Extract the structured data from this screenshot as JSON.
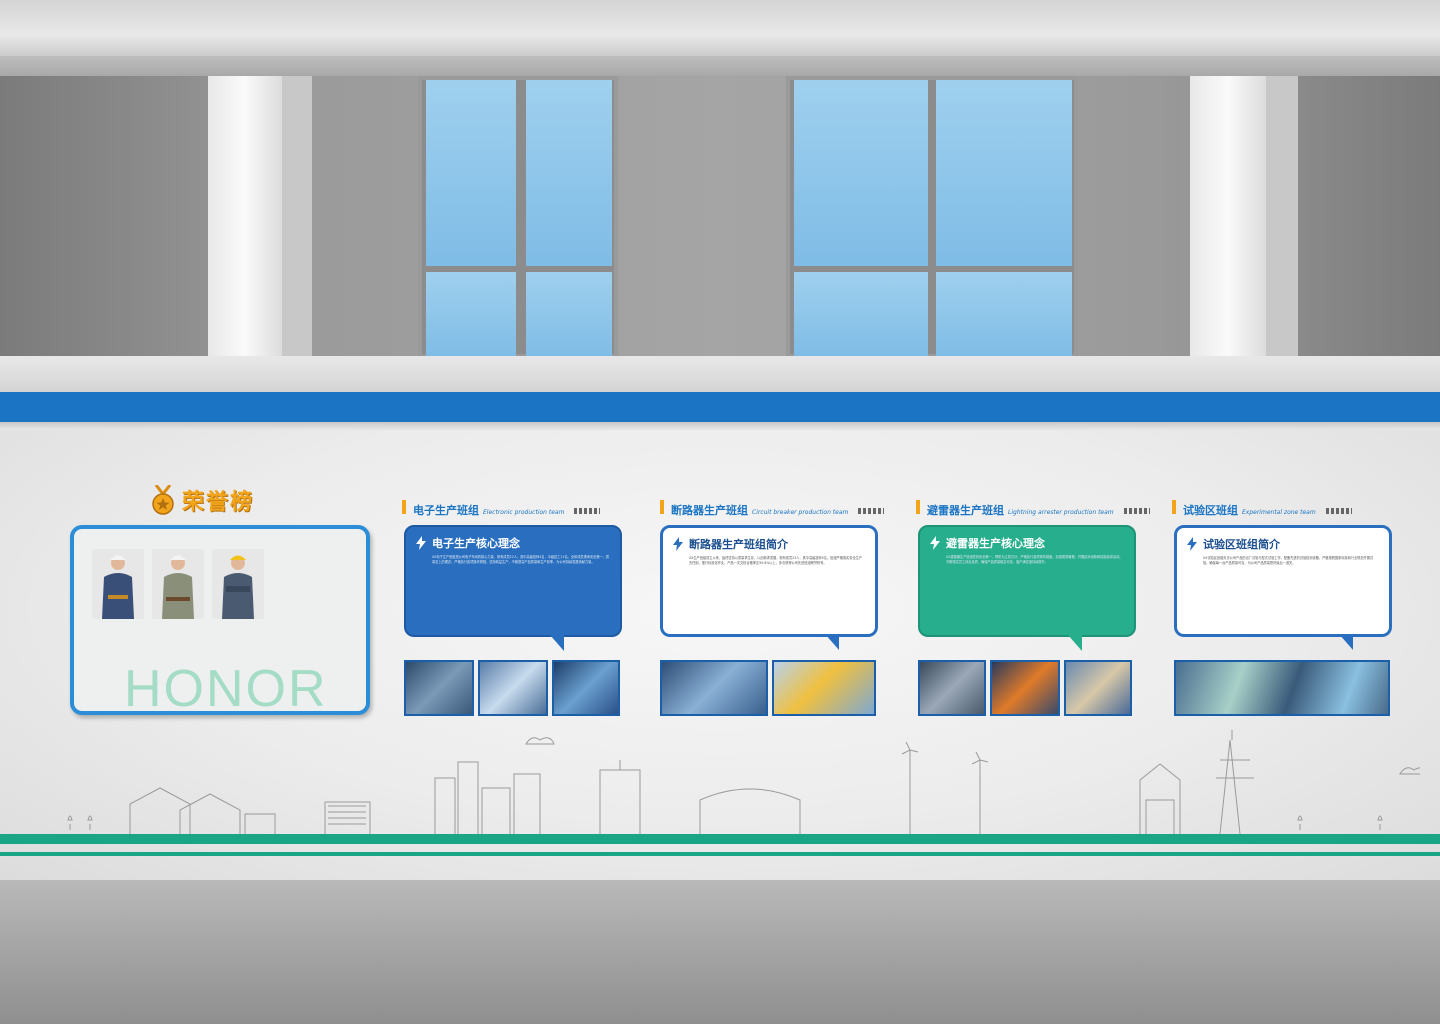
{
  "honor": {
    "title": "荣誉榜",
    "watermark": "HONOR",
    "photos": [
      "worker-1",
      "worker-2",
      "worker-3"
    ]
  },
  "teams": [
    {
      "name_cn": "电子生产班组",
      "name_en": "Electronic production team",
      "panel_title": "电子生产核心理念",
      "panel_style": "blue",
      "body": "XX电子生产班组是公司电子车间的核心力量，现有成员22人，其中高级技师4名，中级技工11名。全体成员秉承安全第一、质量至上的理念，严格执行各项操作规程，坚持精益生产，不断提高产品质量和生产效率，为公司持续发展贡献力量。",
      "photo_count": 3
    },
    {
      "name_cn": "断路器生产班组",
      "name_en": "Circuit breaker production team",
      "panel_title": "断路器生产班组简介",
      "panel_style": "white",
      "body": "XX生产班组成立以来，始终坚持以质量求生存、以创新求发展，现有成员23人，其中高级技师5名。班组严格落实安全生产责任制，推行标准化作业，产品一次交检合格率达99.8%以上，多次获得公司先进班组荣誉称号。",
      "photo_count": 2
    },
    {
      "name_cn": "避雷器生产班组",
      "name_en": "Lightning arrester production team",
      "panel_title": "避雷器生产核心理念",
      "panel_style": "green",
      "body": "XX避雷器生产班组坚持安全第一、预防为主的方针，严格执行各项规章制度，加强现场管理，开展技术创新和技能培训活动，不断提高员工综合素质，确保产品质量稳定可靠，客户满意度持续提升。",
      "photo_count": 3
    },
    {
      "name_cn": "试验区班组",
      "name_en": "Experimental zone team",
      "panel_title": "试验区班组简介",
      "panel_style": "white",
      "body": "XX试验区班组负责公司产品的出厂试验与型式试验工作，配备先进的试验检测设备，严格按照国家标准和行业规范开展试验，确保每一台产品质量可靠，为公司产品质量把好最后一道关。",
      "photo_count": 1
    }
  ],
  "colors": {
    "blue": "#1b75c4",
    "green": "#1aa586",
    "gold": "#f2a51a"
  }
}
